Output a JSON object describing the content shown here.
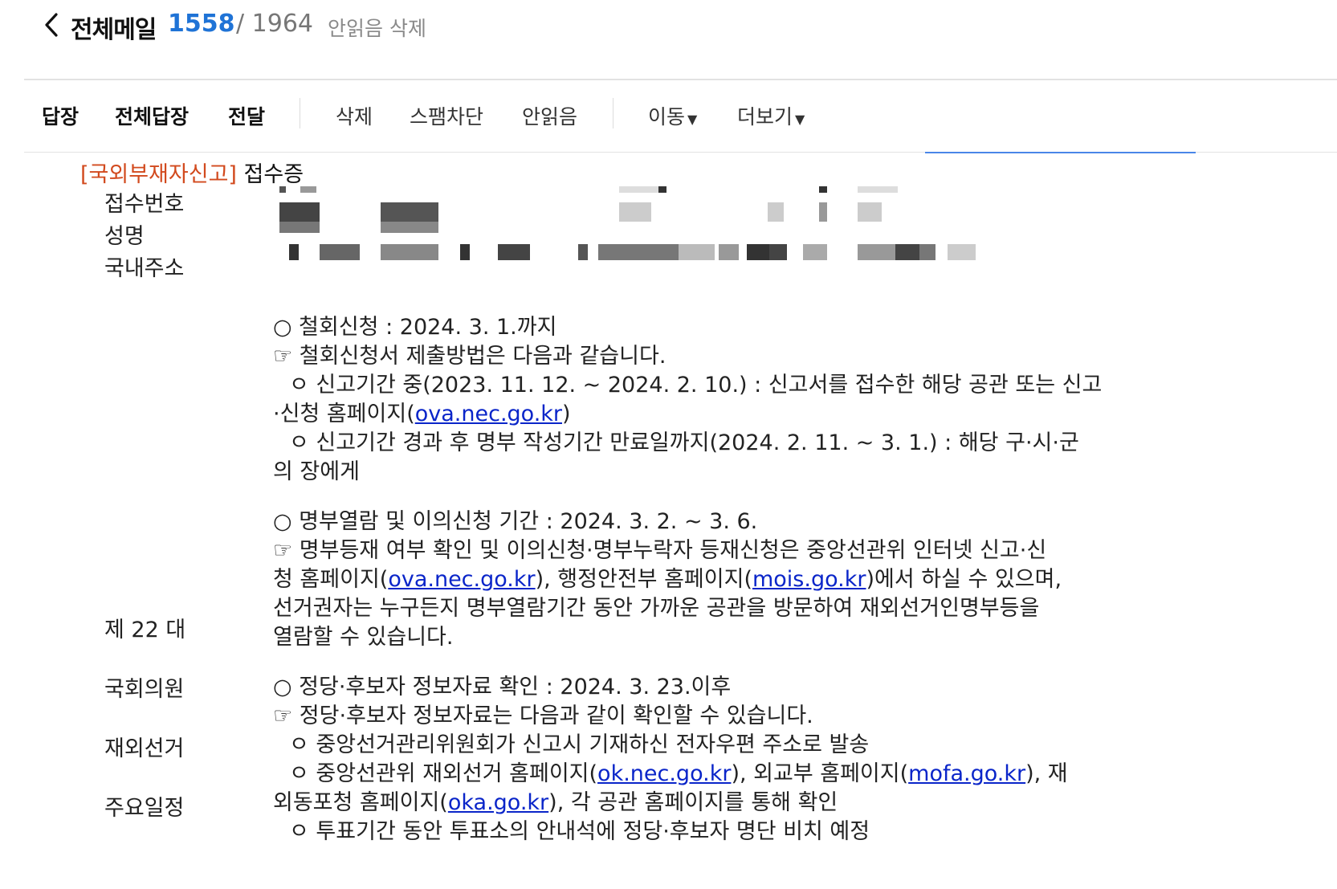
{
  "header": {
    "title": "전체메일",
    "unread_count": "1558",
    "total_count": "/ 1964",
    "delete_unread_label": "안읽음 삭제"
  },
  "toolbar": {
    "reply": "답장",
    "reply_all": "전체답장",
    "forward": "전달",
    "delete": "삭제",
    "block_spam": "스팸차단",
    "mark_unread": "안읽음",
    "move": "이동",
    "more": "더보기",
    "caret": "▼"
  },
  "mail": {
    "subject_tag": "[국외부재자신고]",
    "subject_rest": " 접수증",
    "fields": {
      "receipt_no": "접수번호",
      "name": "성명",
      "address": "국내주소"
    },
    "side_labels": {
      "l1": "제 22 대",
      "l2": "국회의원",
      "l3": "재외선거",
      "l4": "주요일정"
    },
    "s1": {
      "heading": "○ 철회신청 : 2024. 3. 1.까지",
      "note": "☞ 철회신청서 제출방법은 다음과 같습니다.",
      "b1_text": "ㅇ 신고기간 중(2023. 11. 12. ~ 2024. 2. 10.) : 신고서를 접수한 해당 공관 또는 신고",
      "b1_cont_pre": "·신청 홈페이지(",
      "b1_link": "ova.nec.go.kr",
      "b1_cont_post": ")",
      "b2_text": "ㅇ 신고기간 경과 후 명부 작성기간 만료일까지(2024. 2. 11. ~ 3. 1.) : 해당 구·시·군",
      "b2_cont": "의 장에게"
    },
    "s2": {
      "heading": "○ 명부열람 및 이의신청 기간 : 2024. 3. 2. ~ 3. 6.",
      "note": "☞ 명부등재 여부 확인 및 이의신청·명부누락자 등재신청은 중앙선관위 인터넷 신고·신",
      "l2_pre": "청 홈페이지(",
      "link1": "ova.nec.go.kr",
      "l2_mid": "), 행정안전부 홈페이지(",
      "link2": "mois.go.kr",
      "l2_post": ")에서 하실 수 있으며,",
      "l3": "선거권자는 누구든지 명부열람기간 동안 가까운 공관을 방문하여 재외선거인명부등을",
      "l4": "열람할 수 있습니다."
    },
    "s3": {
      "heading": "○ 정당·후보자 정보자료 확인 : 2024. 3. 23.이후",
      "note": "☞ 정당·후보자 정보자료는 다음과 같이 확인할 수 있습니다.",
      "b1": "ㅇ 중앙선거관리위원회가 신고시 기재하신 전자우편 주소로 발송",
      "b2_pre": "ㅇ 중앙선관위 재외선거 홈페이지(",
      "link1": "ok.nec.go.kr",
      "b2_mid": "), 외교부 홈페이지(",
      "link2": "mofa.go.kr",
      "b2_post": "), 재",
      "b2_cont_pre": "외동포청 홈페이지(",
      "link3": "oka.go.kr",
      "b2_cont_post": "), 각 공관 홈페이지를 통해 확인",
      "b3": "ㅇ 투표기간 동안 투표소의 안내석에 정당·후보자 명단 비치 예정"
    }
  }
}
